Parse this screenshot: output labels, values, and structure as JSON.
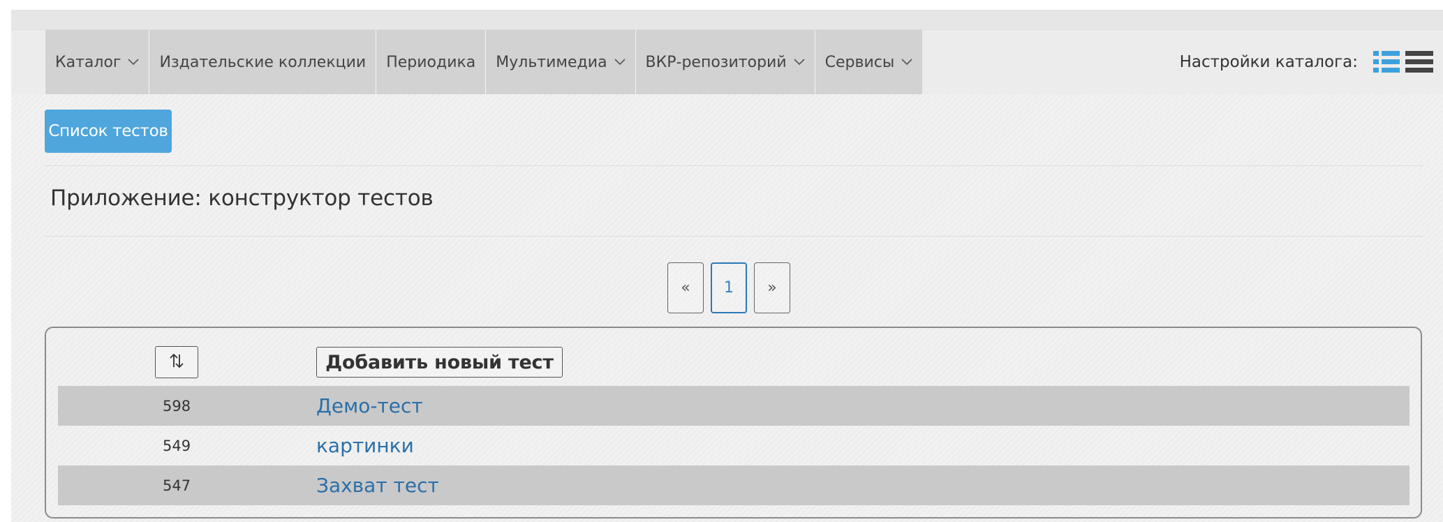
{
  "navbar": {
    "items": [
      {
        "label": "Каталог",
        "has_dropdown": true
      },
      {
        "label": "Издательские коллекции",
        "has_dropdown": false
      },
      {
        "label": "Периодика",
        "has_dropdown": false
      },
      {
        "label": "Мультимедиа",
        "has_dropdown": true
      },
      {
        "label": "ВКР-репозиторий",
        "has_dropdown": true
      },
      {
        "label": "Сервисы",
        "has_dropdown": true
      }
    ],
    "catalog_settings_label": "Настройки каталога:",
    "view_icons": [
      "list-view-icon",
      "compact-list-view-icon"
    ],
    "accent_color": "#3ca0dc"
  },
  "main": {
    "tests_button_label": "Список тестов",
    "app_title": "Приложение: конструктор тестов",
    "pagination": {
      "prev": "«",
      "pages": [
        "1"
      ],
      "current": "1",
      "next": "»"
    },
    "table": {
      "sort_icon": "sort-arrows-icon",
      "add_button_label": "Добавить новый тест",
      "rows": [
        {
          "id": "598",
          "title": "Демо-тест"
        },
        {
          "id": "549",
          "title": "картинки"
        },
        {
          "id": "547",
          "title": "Захват тест"
        }
      ]
    }
  }
}
